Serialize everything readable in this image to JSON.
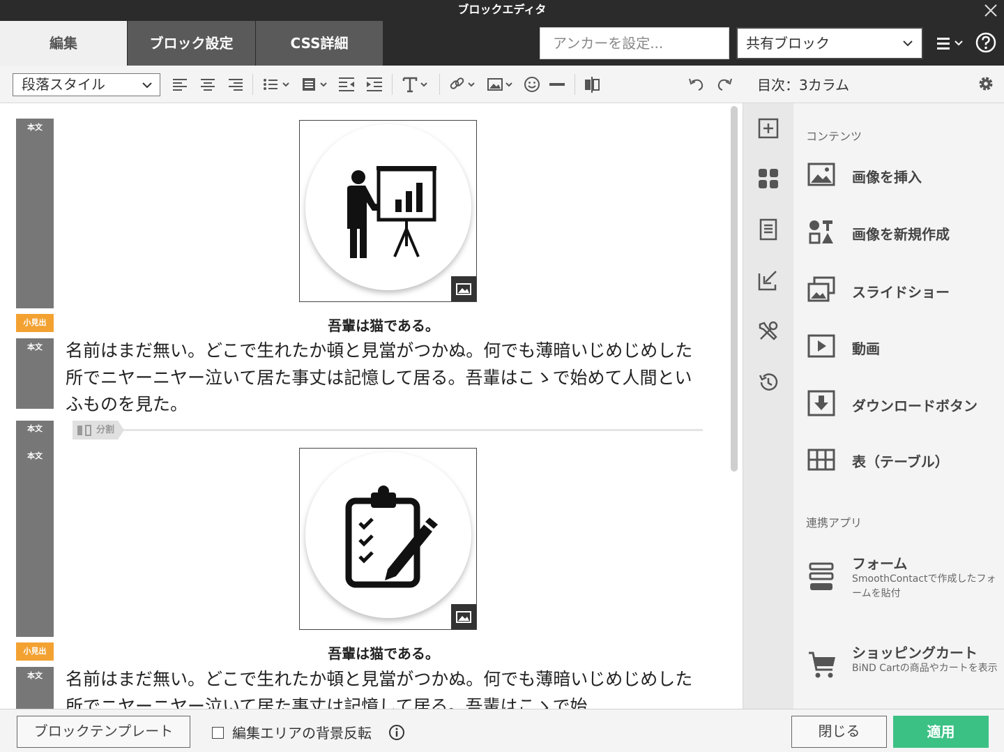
{
  "window": {
    "title": "ブロックエディタ"
  },
  "tabs": [
    {
      "label": "編集",
      "active": true
    },
    {
      "label": "ブロック設定",
      "active": false
    },
    {
      "label": "CSS詳細",
      "active": false
    }
  ],
  "header": {
    "anchor_placeholder": "アンカーを設定...",
    "shared_block": "共有ブロック"
  },
  "toolbar": {
    "paragraph_style": "段落スタイル"
  },
  "editor": {
    "labels": {
      "body": "本文",
      "subheading": "小見出",
      "split": "分割"
    },
    "blocks": [
      {
        "image_icon": "presentation-icon",
        "caption": "吾輩は猫である。",
        "text": "名前はまだ無い。どこで生れたか頓と見當がつかぬ。何でも薄暗いじめじめした所でニヤーニヤー泣いて居た事丈は記憶して居る。吾輩はこゝで始めて人間といふものを見た。"
      },
      {
        "image_icon": "clipboard-checklist-icon",
        "caption": "吾輩は猫である。",
        "text": "名前はまだ無い。どこで生れたか頓と見當がつかぬ。何でも薄暗いじめじめした所でニヤーニヤー泣いて居た事丈は記憶して居る。吾輩はこゝで始"
      }
    ]
  },
  "right_panel": {
    "title": "目次：3カラム",
    "contents_section": "コンテンツ",
    "contents": [
      {
        "icon": "image-icon",
        "label": "画像を挿入"
      },
      {
        "icon": "shapes-icon",
        "label": "画像を新規作成"
      },
      {
        "icon": "slideshow-icon",
        "label": "スライドショー"
      },
      {
        "icon": "video-play-icon",
        "label": "動画"
      },
      {
        "icon": "download-icon",
        "label": "ダウンロードボタン"
      },
      {
        "icon": "table-icon",
        "label": "表（テーブル）"
      }
    ],
    "apps_section": "連携アプリ",
    "apps": [
      {
        "icon": "form-icon",
        "label": "フォーム",
        "desc": "SmoothContactで作成したフォームを貼付"
      },
      {
        "icon": "cart-icon",
        "label": "ショッピングカート",
        "desc": "BiND Cartの商品やカートを表示"
      }
    ]
  },
  "footer": {
    "template_button": "ブロックテンプレート",
    "invert_bg_label": "編集エリアの背景反転",
    "invert_bg_checked": false,
    "close_button": "閉じる",
    "apply_button": "適用"
  }
}
